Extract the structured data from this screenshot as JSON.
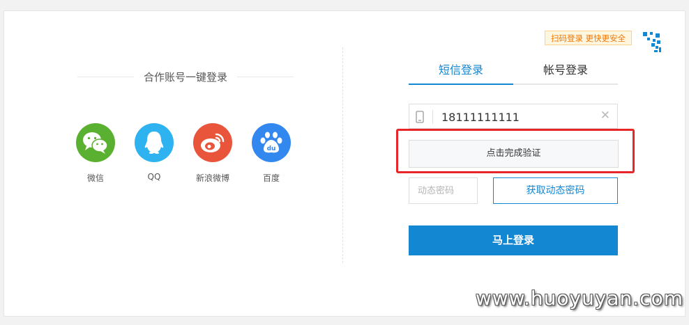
{
  "third_party": {
    "title": "合作账号一键登录",
    "items": [
      {
        "label": "微信",
        "icon": "wechat-icon",
        "color": "#5ab031"
      },
      {
        "label": "QQ",
        "icon": "qq-icon",
        "color": "#2fb3f0"
      },
      {
        "label": "新浪微博",
        "icon": "weibo-icon",
        "color": "#e9553b"
      },
      {
        "label": "百度",
        "icon": "baidu-icon",
        "color": "#3388f0"
      }
    ]
  },
  "qr_login": {
    "tip": "扫码登录 更快更安全",
    "icon": "qrcode-corner-icon"
  },
  "tabs": [
    {
      "label": "短信登录",
      "active": true
    },
    {
      "label": "帐号登录",
      "active": false
    }
  ],
  "form": {
    "phone_value": "18111111111",
    "phone_icon": "mobile-phone-icon",
    "clear_symbol": "✕",
    "verify_label": "点击完成验证",
    "code_placeholder": "动态密码",
    "get_code_label": "获取动态密码",
    "login_label": "马上登录"
  },
  "watermark": "www.huoyuyan.com",
  "colors": {
    "accent": "#1487d2",
    "highlight": "#e8262a",
    "tip_bg": "#fff6e0",
    "tip_text": "#f07800"
  }
}
